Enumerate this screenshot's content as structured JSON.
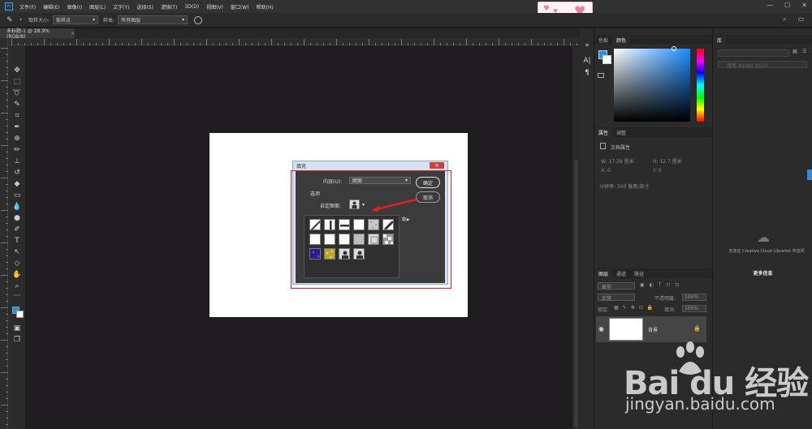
{
  "menu": {
    "logo": "Ps",
    "items": [
      "文件(F)",
      "编辑(E)",
      "图像(I)",
      "图层(L)",
      "文字(Y)",
      "选择(S)",
      "滤镜(T)",
      "3D(D)",
      "视图(V)",
      "窗口(W)",
      "帮助(H)"
    ],
    "window_buttons": [
      "—",
      "☐",
      "✕"
    ]
  },
  "options": {
    "sample_size_label": "取样大小:",
    "sample_size_value": "取样点",
    "sample_label": "样本:",
    "sample_value": "所有图层"
  },
  "document_tab": {
    "title": "未标题-1 @ 28.9%(RGB/8)",
    "close": "×"
  },
  "dialog": {
    "title": "填充",
    "close": "✕",
    "contents_label": "内容(U):",
    "contents_value": "图案",
    "options_label": "选项",
    "custom_pattern_label": "自定图案:",
    "ok_label": "确定",
    "cancel_label": "取消",
    "pattern_row_count": 3
  },
  "panels": {
    "color_tabs": [
      "色板",
      "颜色"
    ],
    "properties_tabs": [
      "属性",
      "调整"
    ],
    "properties_heading": "文档属性",
    "props": {
      "w": "W:  17.28 厘米",
      "h": "H:  12.7 厘米",
      "x": "X:  0",
      "y": "Y:  0",
      "resolution": "分辨率: 300 像素/英寸"
    },
    "layers_tabs": [
      "图层",
      "通道",
      "路径"
    ],
    "layers_kind": "类型",
    "blend_mode": "正常",
    "opacity_label": "不透明度:",
    "opacity_value": "100%",
    "lock_label": "锁定:",
    "fill_label": "填充:",
    "fill_value": "100%",
    "layer_name": "背景",
    "library_tab": "库",
    "library_search": "搜索 Adobe Stock",
    "cloud_text": "无法在 Creative Cloud Libraries 中访问",
    "more_info": "更多信息"
  },
  "watermark": {
    "logo": "Bai du 经验",
    "url": "jingyan.baidu.com"
  },
  "colors": {
    "foreground": "#2a8ee0",
    "background": "#ffffff",
    "highlight": "#e02020",
    "accent": "#31a8ff"
  }
}
